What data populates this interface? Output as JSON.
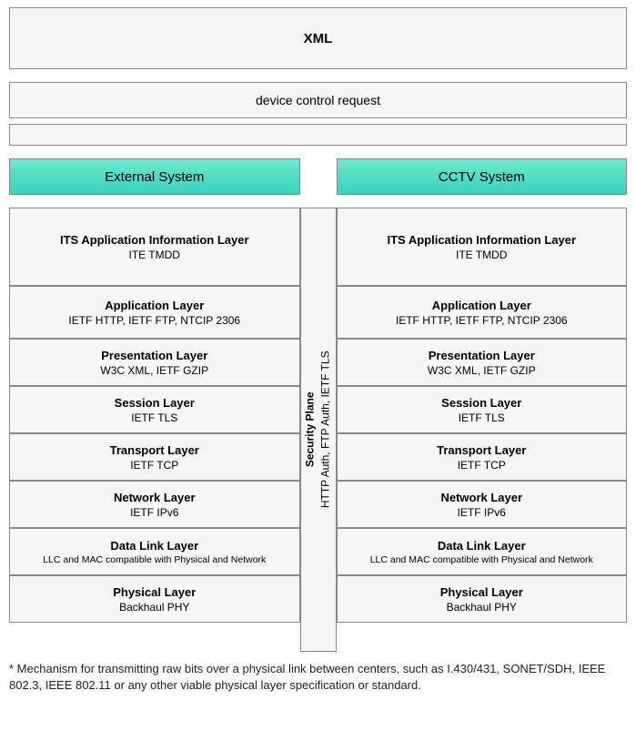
{
  "top": {
    "xml": "XML",
    "device_control": "device control request"
  },
  "left": {
    "header": "External System",
    "layers": [
      {
        "title": "ITS Application Information Layer",
        "sub": "ITE TMDD",
        "size": "tall"
      },
      {
        "title": "Application Layer",
        "sub": "IETF HTTP, IETF FTP, NTCIP 2306",
        "size": "med"
      },
      {
        "title": "Presentation Layer",
        "sub": "W3C XML, IETF GZIP",
        "size": "short"
      },
      {
        "title": "Session Layer",
        "sub": "IETF TLS",
        "size": "short"
      },
      {
        "title": "Transport Layer",
        "sub": "IETF TCP",
        "size": "short"
      },
      {
        "title": "Network Layer",
        "sub": "IETF IPv6",
        "size": "short"
      },
      {
        "title": "Data Link Layer",
        "sub": "LLC and MAC compatible with Physical and Network",
        "size": "short"
      },
      {
        "title": "Physical Layer",
        "sub": "Backhaul PHY",
        "size": "short"
      }
    ]
  },
  "right": {
    "header": "CCTV System",
    "layers": [
      {
        "title": "ITS Application Information Layer",
        "sub": "ITE TMDD",
        "size": "tall"
      },
      {
        "title": "Application Layer",
        "sub": "IETF HTTP, IETF FTP, NTCIP 2306",
        "size": "med"
      },
      {
        "title": "Presentation Layer",
        "sub": "W3C XML, IETF GZIP",
        "size": "short"
      },
      {
        "title": "Session Layer",
        "sub": "IETF TLS",
        "size": "short"
      },
      {
        "title": "Transport Layer",
        "sub": "IETF TCP",
        "size": "short"
      },
      {
        "title": "Network Layer",
        "sub": "IETF IPv6",
        "size": "short"
      },
      {
        "title": "Data Link Layer",
        "sub": "LLC and MAC compatible with Physical and Network",
        "size": "short"
      },
      {
        "title": "Physical Layer",
        "sub": "Backhaul PHY",
        "size": "short"
      }
    ]
  },
  "security": {
    "title": "Security Plane",
    "sub": "HTTP Auth, FTP Auth, IETF TLS"
  },
  "footnote": "* Mechanism for transmitting raw bits over a physical link between centers, such as I.430/431, SONET/SDH, IEEE 802.3, IEEE 802.11 or any other viable physical layer specification or standard."
}
